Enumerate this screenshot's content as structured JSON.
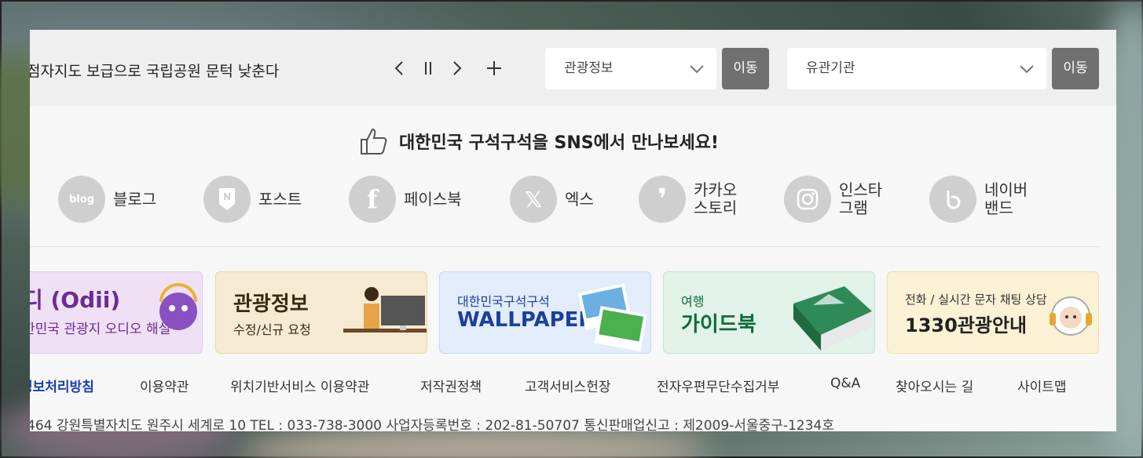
{
  "notice": {
    "text": "점자지도 보급으로 국립공원 문턱 낮춘다"
  },
  "controls": {
    "prev": "‹",
    "pause": "||",
    "next": "›",
    "plus": "+"
  },
  "select1": {
    "value": "관광정보",
    "go": "이동"
  },
  "select2": {
    "value": "유관기관",
    "go": "이동"
  },
  "sns": {
    "title": "대한민국 구석구석을 SNS에서 만나보세요!",
    "items": [
      {
        "icon": "blog",
        "label": "블로그"
      },
      {
        "icon": "N",
        "label": "포스트"
      },
      {
        "icon": "f",
        "label": "페이스북"
      },
      {
        "icon": "X",
        "label": "엑스"
      },
      {
        "icon": ",",
        "label": "카카오\n스토리"
      },
      {
        "icon": "insta",
        "label": "인스타\n그램"
      },
      {
        "icon": "b",
        "label": "네이버\n밴드"
      }
    ]
  },
  "banners": [
    {
      "title": "디 (Odii)",
      "sub": "한민국 관광지 오디오 해설",
      "color": "#efe0f6",
      "accent": "#6a2c91"
    },
    {
      "title": "관광정보",
      "sub": "수정/신규 요청",
      "color": "#f7ead2",
      "accent": "#3a2a10"
    },
    {
      "title": "WALLPAPER",
      "sub": "대한민국구석구석",
      "color": "#e2ecfb",
      "accent": "#1c3f9c"
    },
    {
      "title": "가이드북",
      "sub": "여행",
      "color": "#e1f2e8",
      "accent": "#0f6b3a"
    },
    {
      "title": "1330관광안내",
      "sub": "전화 / 실시간 문자 채팅 상담",
      "color": "#fbf1d4",
      "accent": "#222"
    }
  ],
  "footer": {
    "links": [
      "정보처리방침",
      "이용약관",
      "위치기반서비스 이용약관",
      "저작권정책",
      "고객서비스헌장",
      "전자우편무단수집거부",
      "Q&A",
      "찾아오시는 길",
      "사이트맵"
    ],
    "address": "464   강원특별자치도 원주시 세계로 10   TEL : 033-738-3000   사업자등록번호 : 202-81-50707   통신판매업신고 : 제2009-서울중구-1234호"
  },
  "colors": {
    "accent_link": "#1a3faa",
    "button_gray": "#707070",
    "icon_gray": "#cfcfcf"
  }
}
